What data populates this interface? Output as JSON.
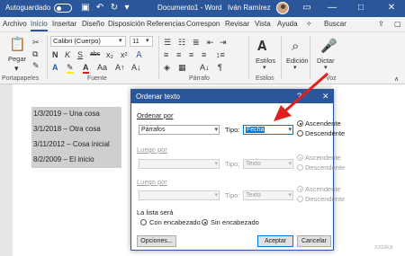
{
  "titlebar": {
    "autosave_label": "Autoguardado",
    "save_icon": "save-icon",
    "undo_icon": "undo-icon",
    "redo_icon": "redo-icon",
    "document_title": "Documento1  -  Word",
    "user_name": "Iván Ramírez",
    "controls": [
      "—",
      "□",
      "✕"
    ],
    "accent": "#2b579a"
  },
  "menu": {
    "items": [
      "Archivo",
      "Inicio",
      "Insertar",
      "Diseño",
      "Disposición",
      "Referencias",
      "Correspon",
      "Revisar",
      "Vista",
      "Ayuda"
    ],
    "active": "Inicio",
    "search_label": "Buscar"
  },
  "ribbon": {
    "paste_label": "Pegar",
    "font_name": "Calibri (Cuerpo)",
    "font_size": "11",
    "group_portapapeles": "Portapapeles",
    "group_fuente": "Fuente",
    "group_parrafo": "Párrafo",
    "group_estilos": "Estilos",
    "group_voz": "Voz",
    "styles_label": "Estilos",
    "editing_label": "Edición",
    "dictate_label": "Dictar",
    "font_buttons": [
      "N",
      "K",
      "S",
      "abc",
      "x₂",
      "x²"
    ]
  },
  "document": {
    "lines": [
      "1/3/2019 – Una cosa",
      "3/1/2018 – Otra cosa",
      "3/11/2012 – Cosa inicial",
      "8/2/2009 – El inicio"
    ]
  },
  "dialog": {
    "title": "Ordenar texto",
    "help": "?",
    "close": "✕",
    "sort_by_label": "Ordenar por",
    "sort_by_value": "Párrafos",
    "type_label": "Tipo:",
    "type_value": "Fecha",
    "asc_label": "Ascendente",
    "desc_label": "Descendente",
    "then_by_label": "Luego por",
    "then_by2_label": "Luego por",
    "then_type_value": "Texto",
    "then_type2_value": "Texto",
    "list_has_label": "La lista será",
    "with_header_label": "Con encabezado",
    "no_header_label": "Sin encabezado",
    "options_button": "Opciones...",
    "ok_button": "Aceptar",
    "cancel_button": "Cancelar",
    "arrow_color": "#e0201b"
  },
  "watermark": "xataka"
}
